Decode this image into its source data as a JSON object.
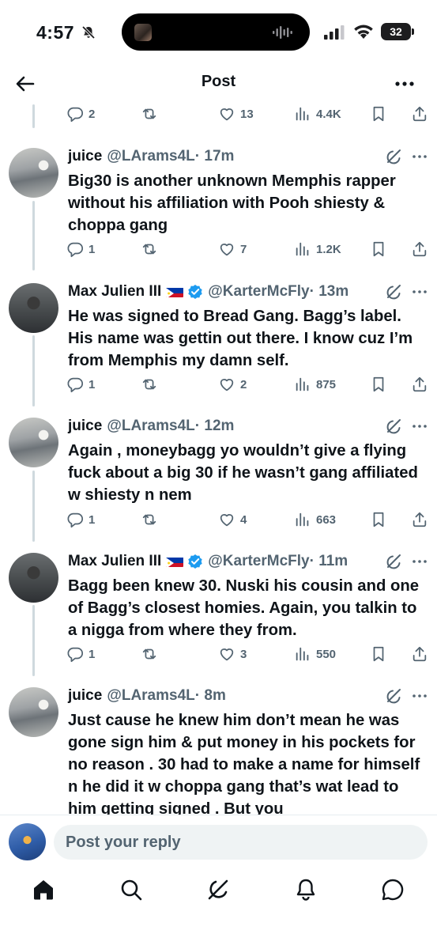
{
  "status_bar": {
    "time": "4:57",
    "battery": "32"
  },
  "header": {
    "title": "Post"
  },
  "first_actions": {
    "replies": "2",
    "reposts": "",
    "likes": "13",
    "views": "4.4K"
  },
  "tweets": [
    {
      "name": "juice",
      "handle": "@LArams4L",
      "time": "· 17m",
      "text": "Big30 is another unknown Memphis rapper without his affiliation with Pooh shiesty & choppa gang",
      "replies": "1",
      "reposts": "",
      "likes": "7",
      "views": "1.2K"
    },
    {
      "name": "Max Julien III",
      "handle": "@KarterMcFly",
      "time": "· 13m",
      "text": "He was signed to Bread Gang. Bagg’s label. His name was gettin out there. I know cuz I’m from Memphis my damn self.",
      "replies": "1",
      "reposts": "",
      "likes": "2",
      "views": "875"
    },
    {
      "name": "juice",
      "handle": "@LArams4L",
      "time": "· 12m",
      "text": "Again , moneybagg yo wouldn’t give a flying fuck about a big 30 if he wasn’t gang affiliated w shiesty n nem",
      "replies": "1",
      "reposts": "",
      "likes": "4",
      "views": "663"
    },
    {
      "name": "Max Julien III",
      "handle": "@KarterMcFly",
      "time": "· 11m",
      "text": "Bagg been knew 30. Nuski his cousin and one of Bagg’s closest homies. Again, you talkin to a nigga from where they from.",
      "replies": "1",
      "reposts": "",
      "likes": "3",
      "views": "550"
    },
    {
      "name": "juice",
      "handle": "@LArams4L",
      "time": "· 8m",
      "text": "Just cause he knew him don’t mean he was gone sign him & put money in his pockets for no reason . 30 had to make a name for himself n he did it w choppa gang that’s wat lead  to him  getting signed . But you"
    }
  ],
  "reply_bar": {
    "placeholder": "Post your reply"
  },
  "colors": {
    "text": "#0f1419",
    "muted": "#536471",
    "verified": "#1d9bf0",
    "thread_line": "#cfd9de"
  }
}
